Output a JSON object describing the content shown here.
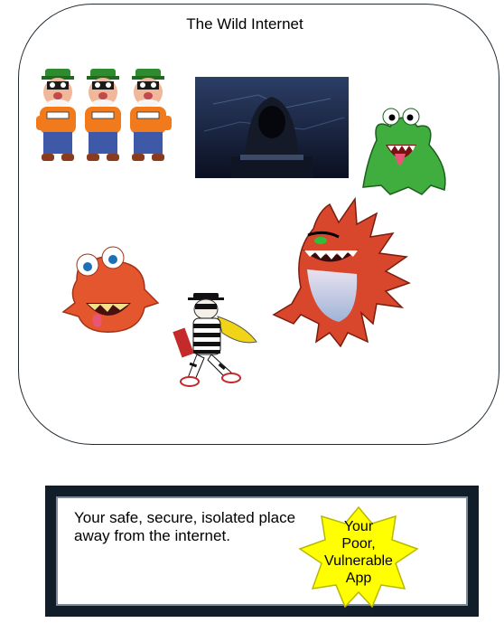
{
  "internet_region": {
    "title": "The Wild Internet",
    "figures": [
      {
        "name": "three-burglars",
        "description_icon": "burglar-trio-icon"
      },
      {
        "name": "hooded-hacker",
        "description_icon": "hacker-icon"
      },
      {
        "name": "green-monster",
        "description_icon": "green-monster-icon"
      },
      {
        "name": "red-blob-monster",
        "description_icon": "red-blob-icon"
      },
      {
        "name": "striped-robber",
        "description_icon": "robber-icon"
      },
      {
        "name": "spiky-red-monster",
        "description_icon": "spiky-monster-icon"
      }
    ]
  },
  "safe_region": {
    "text": "Your safe, secure, isolated place away from the internet.",
    "app_label_lines": [
      "Your",
      "Poor,",
      "Vulnerable",
      "App"
    ]
  },
  "colors": {
    "region_border": "#1f2a33",
    "safe_frame": "#121d2a",
    "app_star": "#ffff00",
    "app_star_border": "#b8b800"
  }
}
